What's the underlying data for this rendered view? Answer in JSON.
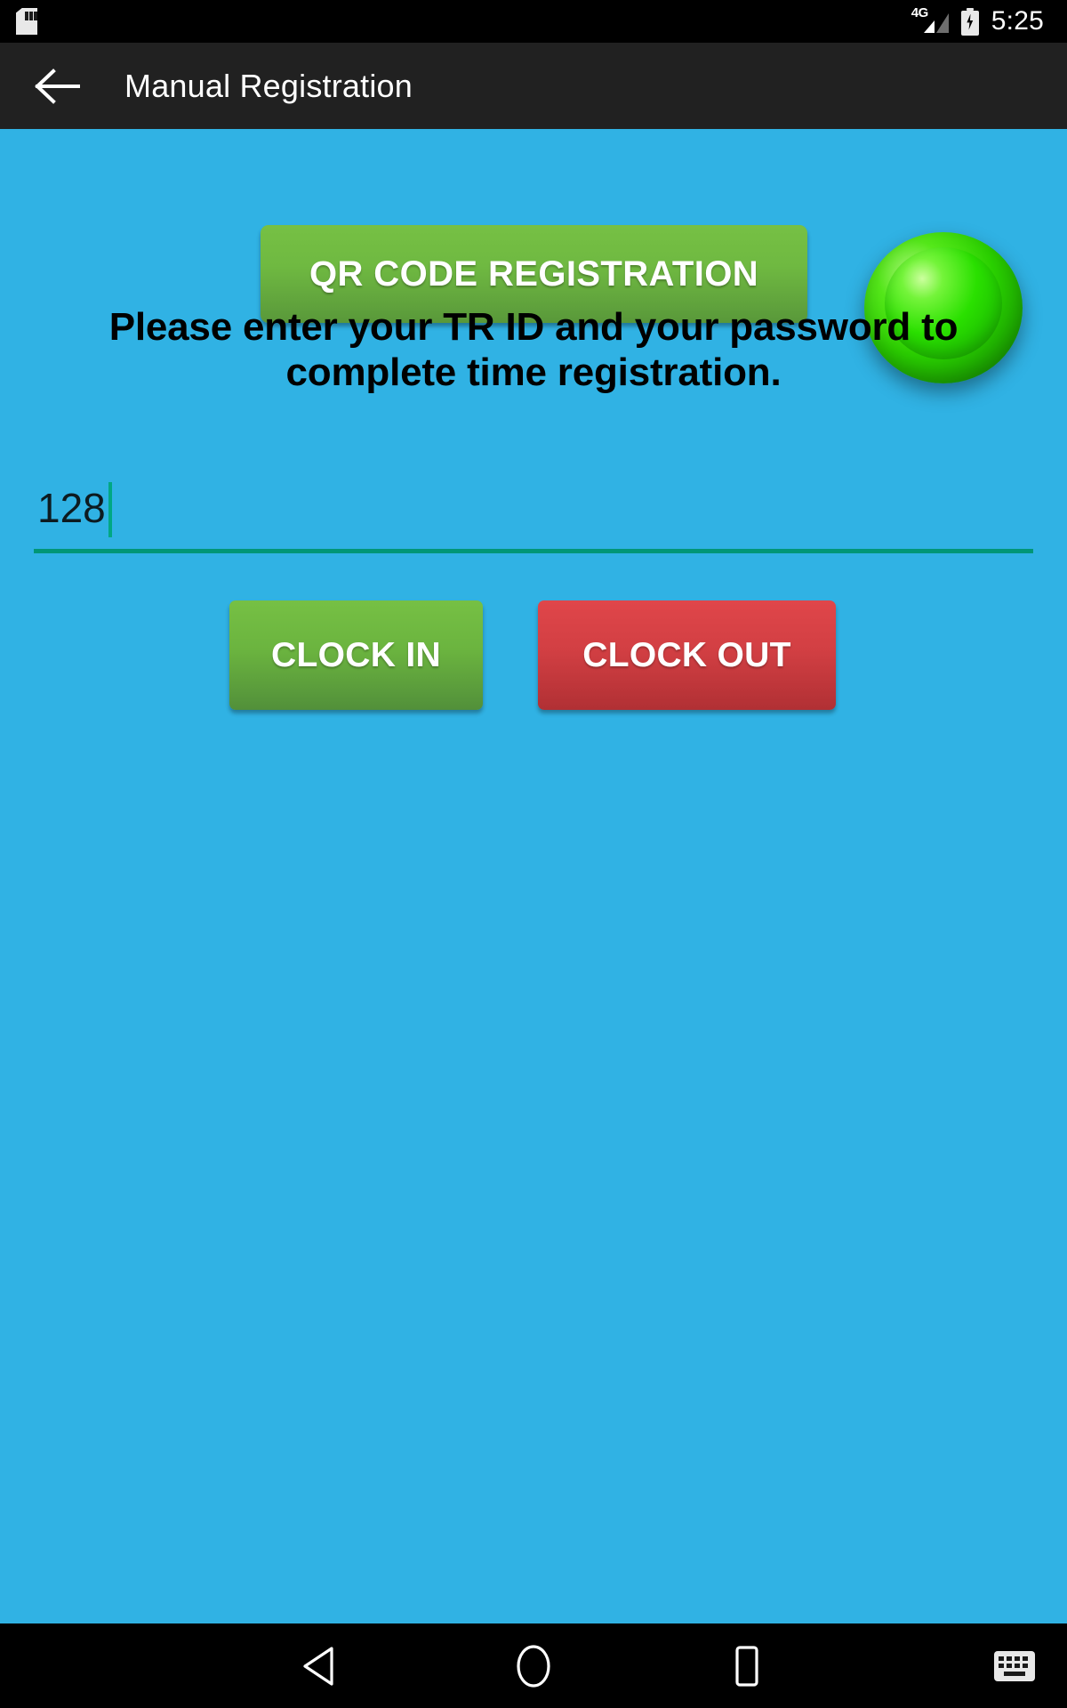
{
  "status_bar": {
    "sd_card_icon": "sd-card-icon",
    "network_label": "4G",
    "signal_icon": "signal-bars-icon",
    "battery_icon": "battery-charging-icon",
    "time": "5:25"
  },
  "app_bar": {
    "back_icon": "back-arrow-icon",
    "title": "Manual Registration"
  },
  "main": {
    "qr_button_label": "QR CODE REGISTRATION",
    "status_lamp": "green-status-indicator",
    "instructions": "Please enter your TR ID and your password to complete time registration.",
    "id_input_value": "128",
    "id_input_placeholder": "",
    "clock_in_label": "CLOCK IN",
    "clock_out_label": "CLOCK OUT"
  },
  "nav_bar": {
    "back_icon": "nav-back-triangle-icon",
    "home_icon": "nav-home-circle-icon",
    "recents_icon": "nav-recents-square-icon",
    "keyboard_icon": "nav-keyboard-icon"
  },
  "colors": {
    "background_blue": "#30b2e4",
    "app_bar_dark": "#212121",
    "status_bar_black": "#000000",
    "green_button": "#6fb941",
    "red_button": "#d23f43",
    "input_underline_teal": "#009677",
    "lamp_green": "#2ad000"
  }
}
